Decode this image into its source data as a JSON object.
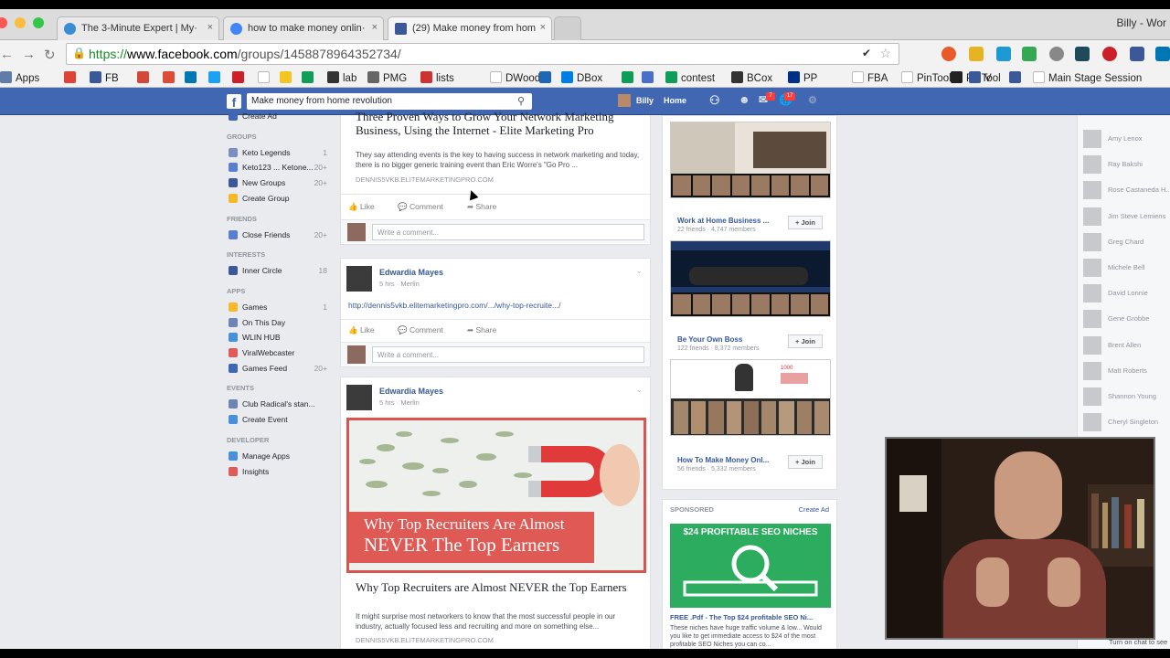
{
  "browser": {
    "tabs": [
      {
        "title": "The 3-Minute Expert | My·",
        "active": false,
        "favicon_color": "#3a8dd4"
      },
      {
        "title": "how to make money onlin·",
        "active": false,
        "favicon_color": "#4285f4"
      },
      {
        "title": "(29) Make money from hom",
        "active": true,
        "favicon_color": "#3b5998"
      }
    ],
    "tab_close": "×",
    "profile_name": "Billy - Wor",
    "url_scheme": "https://",
    "url_domain": "www.facebook.com",
    "url_path": "/groups/1458878964352734/",
    "bookmarks": [
      {
        "label": "Apps",
        "color": "#5f7da8"
      },
      {
        "label": "",
        "color": "#db4437"
      },
      {
        "label": "FB",
        "color": "#3b5998"
      },
      {
        "label": "",
        "color": "#d44638"
      },
      {
        "label": "",
        "color": "#dd4b39"
      },
      {
        "label": "",
        "color": "#0077b5"
      },
      {
        "label": "",
        "color": "#1da1f2"
      },
      {
        "label": "",
        "color": "#cb2027"
      },
      {
        "label": "",
        "color": "#ffffff"
      },
      {
        "label": "",
        "color": "#f3c623"
      },
      {
        "label": "",
        "color": "#0f9d58"
      },
      {
        "label": "lab",
        "color": "#333333"
      },
      {
        "label": "PMG",
        "color": "#666666"
      },
      {
        "label": "lists",
        "color": "#cc3333"
      },
      {
        "label": "DWood",
        "color": "#ffffff"
      },
      {
        "label": "",
        "color": "#1f66b3"
      },
      {
        "label": "DBox",
        "color": "#007ee5"
      },
      {
        "label": "",
        "color": "#0f9d58"
      },
      {
        "label": "",
        "color": "#4a6fc7"
      },
      {
        "label": "contest",
        "color": "#0f9d58"
      },
      {
        "label": "BCox",
        "color": "#333333"
      },
      {
        "label": "PP",
        "color": "#003087"
      },
      {
        "label": "PinTool",
        "color": "#bd081c"
      },
      {
        "label": "FBA",
        "color": "#ffffff"
      },
      {
        "label": "PinTool",
        "color": "#ffffff"
      },
      {
        "label": "",
        "color": "#222222"
      },
      {
        "label": "V",
        "color": "#3b5998"
      },
      {
        "label": "",
        "color": "#3b5998"
      },
      {
        "label": "Main Stage Session",
        "color": "#ffffff"
      }
    ]
  },
  "fb": {
    "search_value": "Make money from home revolution",
    "nav": {
      "user": "Billy",
      "home": "Home",
      "friend_requests": "",
      "messages": "7",
      "notifications": "17"
    },
    "leftnav": {
      "sections": [
        {
          "label": "",
          "items": [
            {
              "label": "Create Ad",
              "count": ""
            }
          ]
        },
        {
          "label": "GROUPS",
          "items": [
            {
              "label": "Keto Legends",
              "count": "1"
            },
            {
              "label": "Keto123 ... Ketone...",
              "count": "20+"
            },
            {
              "label": "New Groups",
              "count": "20+"
            },
            {
              "label": "Create Group",
              "count": ""
            }
          ]
        },
        {
          "label": "FRIENDS",
          "items": [
            {
              "label": "Close Friends",
              "count": "20+"
            }
          ]
        },
        {
          "label": "INTERESTS",
          "items": [
            {
              "label": "Inner Circle",
              "count": "18"
            }
          ]
        },
        {
          "label": "APPS",
          "items": [
            {
              "label": "Games",
              "count": "1"
            },
            {
              "label": "On This Day",
              "count": ""
            },
            {
              "label": "WLIN HUB",
              "count": ""
            },
            {
              "label": "ViralWebcaster",
              "count": ""
            },
            {
              "label": "Games Feed",
              "count": "20+"
            }
          ]
        },
        {
          "label": "EVENTS",
          "items": [
            {
              "label": "Club Radical's stan...",
              "count": ""
            },
            {
              "label": "Create Event",
              "count": ""
            }
          ]
        },
        {
          "label": "DEVELOPER",
          "items": [
            {
              "label": "Manage Apps",
              "count": ""
            },
            {
              "label": "Insights",
              "count": ""
            }
          ]
        }
      ]
    },
    "posts": [
      {
        "link_title": "Three Proven Ways to Grow Your Network Marketing Business, Using the Internet - Elite Marketing Pro",
        "link_desc": "They say attending events is the key to having success in network marketing and today, there is no bigger generic training event than Eric Worre's \"Go Pro ...",
        "link_domain": "DENNIS5VKB.ELITEMARKETINGPRO.COM",
        "actions": {
          "like": "Like",
          "comment": "Comment",
          "share": "Share"
        },
        "comment_placeholder": "Write a comment..."
      },
      {
        "author": "Edwardia Mayes",
        "meta": "5 hrs · Merlin",
        "text": "http://dennis5vkb.elitemarketingpro.com/.../why-top-recruite.../",
        "actions": {
          "like": "Like",
          "comment": "Comment",
          "share": "Share"
        },
        "comment_placeholder": "Write a comment..."
      },
      {
        "author": "Edwardia Mayes",
        "meta": "5 hrs · Merlin",
        "image_headline_1": "Why Top Recruiters Are Almost",
        "image_headline_2": "NEVER The Top Earners",
        "link_title": "Why Top Recruiters are Almost NEVER the Top Earners",
        "link_desc": "It might surprise most networkers to know that the most successful people in our industry, actually focused less and recruiting and more on something else...",
        "link_domain": "DENNIS5VKB.ELITEMARKETINGPRO.COM"
      }
    ],
    "suggested_groups": [
      {
        "name": "Work at Home Business ...",
        "meta": "22 friends · 4,747 members",
        "join": "+ Join"
      },
      {
        "name": "Be Your Own Boss",
        "meta": "122 friends · 8,372 members",
        "join": "+ Join"
      },
      {
        "name": "How To Make Money Onl...",
        "meta": "56 friends · 5,332 members",
        "join": "+ Join"
      }
    ],
    "group3_thumb_label": "1000",
    "sponsored": {
      "header": "SPONSORED",
      "create_ad": "Create Ad",
      "ad_banner": "$24 PROFITABLE SEO NICHES",
      "ad_title": "FREE .Pdf - The Top $24 profitable SEO Ni...",
      "ad_desc": "These niches have huge traffic volume & low... Would you like to get immediate access to $24 of the most profitable SEO Niches you can co..."
    },
    "chat_contacts": [
      "Amy Lenox",
      "Ray Bakshi",
      "Rose Castaneda H...",
      "Jim Steve Lemiens",
      "Greg Chard",
      "Michele Bell",
      "David Lonnie",
      "Gene Grobbe",
      "Brent Allen",
      "Matt Roberts",
      "Shannon Young",
      "Cheryl Singleton"
    ],
    "chat_more": "Turn on chat to see"
  },
  "colors": {
    "fb_blue": "#4267b2",
    "link_blue": "#365899",
    "ad_green": "#2bac5e",
    "image_red": "#d9534f"
  }
}
